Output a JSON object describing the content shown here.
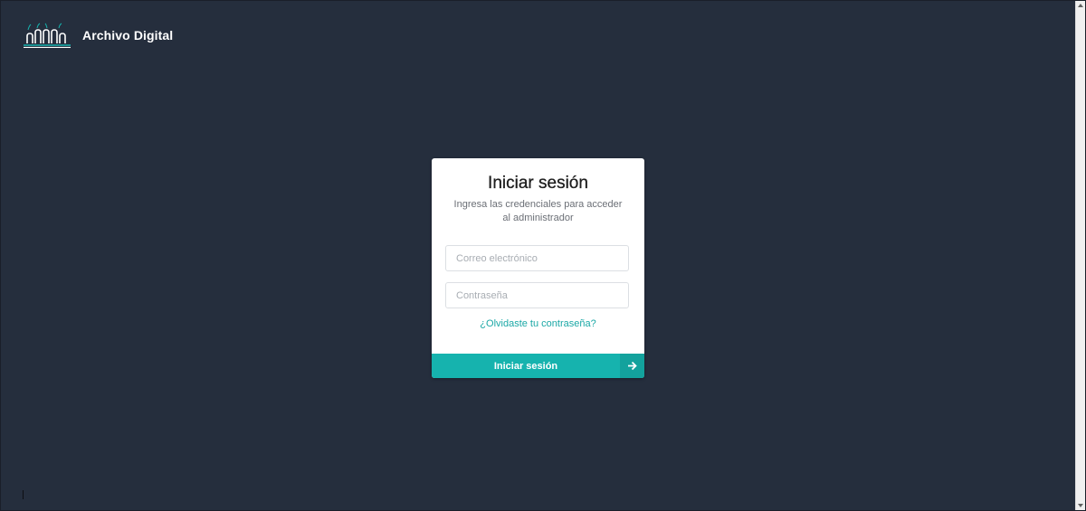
{
  "brand": {
    "name": "Archivo Digital",
    "accent_color": "#16b3ae",
    "logo_icon": "archive-buildings-icon"
  },
  "login": {
    "title": "Iniciar sesión",
    "subtitle": "Ingresa las credenciales para acceder al administrador",
    "email": {
      "value": "",
      "placeholder": "Correo electrónico"
    },
    "password": {
      "value": "",
      "placeholder": "Contraseña"
    },
    "forgot_label": "¿Olvidaste tu contraseña?",
    "submit_label": "Iniciar sesión",
    "submit_icon": "arrow-right-icon"
  },
  "colors": {
    "background": "#252e3d",
    "button": "#16b3ae",
    "link": "#1ba8a6"
  }
}
